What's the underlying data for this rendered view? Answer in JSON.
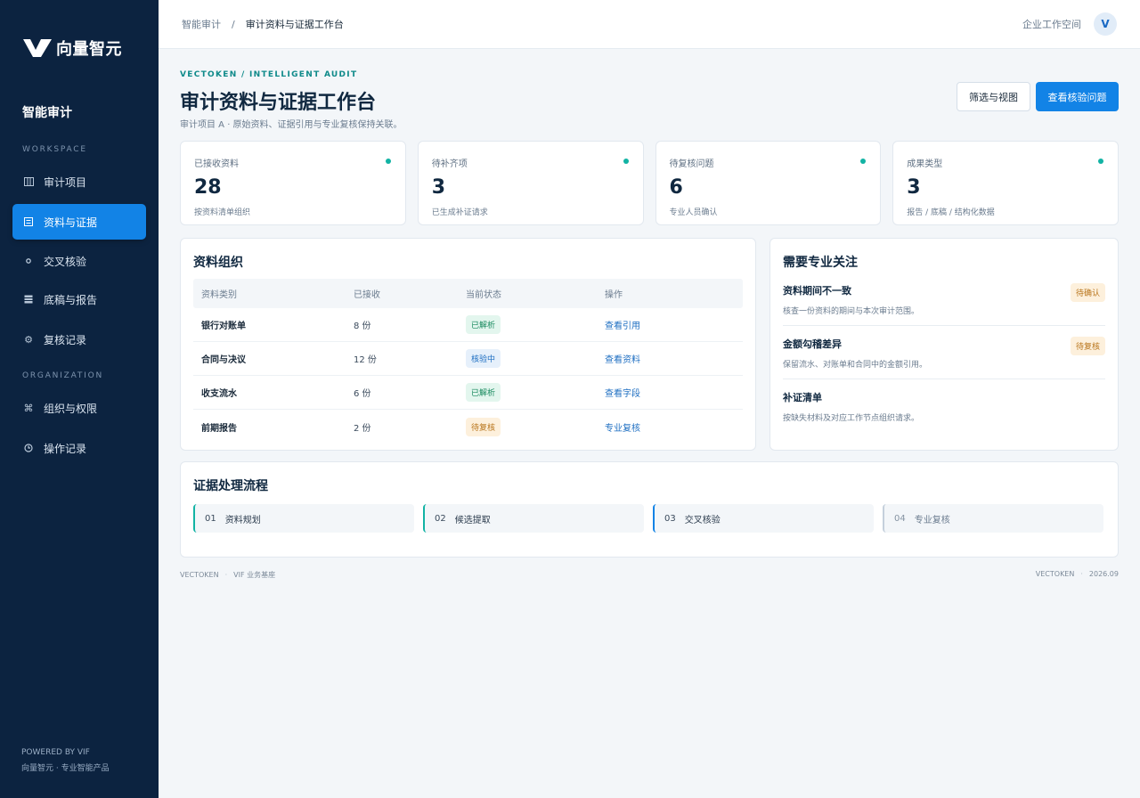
{
  "brand": {
    "name": "向量智元"
  },
  "sidebar": {
    "title": "智能审计",
    "sections": {
      "workspace": "WORKSPACE",
      "organization": "ORGANIZATION"
    },
    "items": [
      {
        "label": "审计项目",
        "icon": "columns-icon"
      },
      {
        "label": "资料与证据",
        "icon": "document-icon"
      },
      {
        "label": "交叉核验",
        "icon": "dot-icon"
      },
      {
        "label": "底稿与报告",
        "icon": "grid-icon"
      },
      {
        "label": "复核记录",
        "icon": "gear-icon"
      },
      {
        "label": "组织与权限",
        "icon": "command-icon"
      },
      {
        "label": "操作记录",
        "icon": "clock-icon"
      }
    ],
    "footer": {
      "line1": "POWERED BY VIF",
      "line2": "向量智元 · 专业智能产品"
    }
  },
  "topbar": {
    "crumb_root": "智能审计",
    "crumb_sep": "/",
    "crumb_current": "审计资料与证据工作台",
    "workspace": "企业工作空间",
    "avatar": "V"
  },
  "header": {
    "eyebrow": "VECTOKEN / INTELLIGENT AUDIT",
    "title": "审计资料与证据工作台",
    "subtitle": "审计项目 A · 原始资料、证据引用与专业复核保持关联。",
    "filter_button": "筛选与视图",
    "primary_button": "查看核验问题"
  },
  "stats": [
    {
      "label": "已接收资料",
      "value": "28",
      "note": "按资料清单组织"
    },
    {
      "label": "待补齐项",
      "value": "3",
      "note": "已生成补证请求"
    },
    {
      "label": "待复核问题",
      "value": "6",
      "note": "专业人员确认"
    },
    {
      "label": "成果类型",
      "value": "3",
      "note": "报告 / 底稿 / 结构化数据"
    }
  ],
  "materials": {
    "title": "资料组织",
    "columns": [
      "资料类别",
      "已接收",
      "当前状态",
      "操作"
    ],
    "rows": [
      {
        "category": "银行对账单",
        "count": "8 份",
        "status": "已解析",
        "status_kind": "green",
        "action": "查看引用"
      },
      {
        "category": "合同与决议",
        "count": "12 份",
        "status": "核验中",
        "status_kind": "blue",
        "action": "查看资料"
      },
      {
        "category": "收支流水",
        "count": "6 份",
        "status": "已解析",
        "status_kind": "green",
        "action": "查看字段"
      },
      {
        "category": "前期报告",
        "count": "2 份",
        "status": "待复核",
        "status_kind": "orange",
        "action": "专业复核"
      }
    ]
  },
  "attention": {
    "title": "需要专业关注",
    "items": [
      {
        "title": "资料期间不一致",
        "desc": "核查一份资料的期间与本次审计范围。",
        "badge": "待确认"
      },
      {
        "title": "金额勾稽差异",
        "desc": "保留流水、对账单和合同中的金额引用。",
        "badge": "待复核"
      },
      {
        "title": "补证清单",
        "desc": "按缺失材料及对应工作节点组织请求。",
        "badge": ""
      }
    ]
  },
  "flow": {
    "title": "证据处理流程",
    "steps": [
      {
        "num": "01",
        "label": "资料规划"
      },
      {
        "num": "02",
        "label": "候选提取"
      },
      {
        "num": "03",
        "label": "交叉核验"
      },
      {
        "num": "04",
        "label": "专业复核"
      }
    ]
  },
  "footer": {
    "left_a": "VECTOKEN",
    "left_b": "VIF 业务基座",
    "right_a": "VECTOKEN",
    "right_b": "2026.09",
    "sep": "·"
  },
  "colors": {
    "sidebar": "#0c2340",
    "accent": "#1283e6",
    "teal": "#12b3a4"
  }
}
